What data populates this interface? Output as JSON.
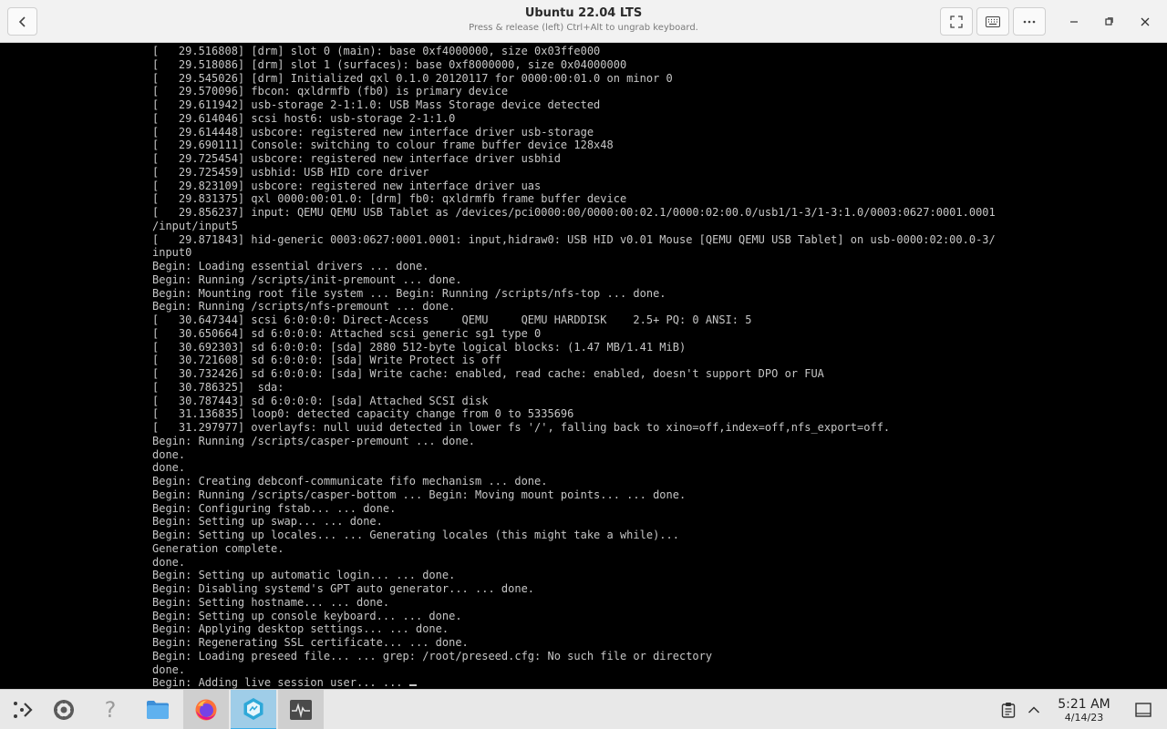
{
  "window": {
    "title": "Ubuntu 22.04 LTS",
    "subtitle": "Press & release (left) Ctrl+Alt to ungrab keyboard."
  },
  "terminal": {
    "lines": [
      "[   29.516808] [drm] slot 0 (main): base 0xf4000000, size 0x03ffe000",
      "[   29.518086] [drm] slot 1 (surfaces): base 0xf8000000, size 0x04000000",
      "[   29.545026] [drm] Initialized qxl 0.1.0 20120117 for 0000:00:01.0 on minor 0",
      "[   29.570096] fbcon: qxldrmfb (fb0) is primary device",
      "[   29.611942] usb-storage 2-1:1.0: USB Mass Storage device detected",
      "[   29.614046] scsi host6: usb-storage 2-1:1.0",
      "[   29.614448] usbcore: registered new interface driver usb-storage",
      "[   29.690111] Console: switching to colour frame buffer device 128x48",
      "[   29.725454] usbcore: registered new interface driver usbhid",
      "[   29.725459] usbhid: USB HID core driver",
      "[   29.823109] usbcore: registered new interface driver uas",
      "[   29.831375] qxl 0000:00:01.0: [drm] fb0: qxldrmfb frame buffer device",
      "[   29.856237] input: QEMU QEMU USB Tablet as /devices/pci0000:00/0000:00:02.1/0000:02:00.0/usb1/1-3/1-3:1.0/0003:0627:0001.0001",
      "/input/input5",
      "[   29.871843] hid-generic 0003:0627:0001.0001: input,hidraw0: USB HID v0.01 Mouse [QEMU QEMU USB Tablet] on usb-0000:02:00.0-3/",
      "input0",
      "Begin: Loading essential drivers ... done.",
      "Begin: Running /scripts/init-premount ... done.",
      "Begin: Mounting root file system ... Begin: Running /scripts/nfs-top ... done.",
      "Begin: Running /scripts/nfs-premount ... done.",
      "[   30.647344] scsi 6:0:0:0: Direct-Access     QEMU     QEMU HARDDISK    2.5+ PQ: 0 ANSI: 5",
      "[   30.650664] sd 6:0:0:0: Attached scsi generic sg1 type 0",
      "[   30.692303] sd 6:0:0:0: [sda] 2880 512-byte logical blocks: (1.47 MB/1.41 MiB)",
      "[   30.721608] sd 6:0:0:0: [sda] Write Protect is off",
      "[   30.732426] sd 6:0:0:0: [sda] Write cache: enabled, read cache: enabled, doesn't support DPO or FUA",
      "[   30.786325]  sda:",
      "[   30.787443] sd 6:0:0:0: [sda] Attached SCSI disk",
      "[   31.136835] loop0: detected capacity change from 0 to 5335696",
      "[   31.297977] overlayfs: null uuid detected in lower fs '/', falling back to xino=off,index=off,nfs_export=off.",
      "Begin: Running /scripts/casper-premount ... done.",
      "done.",
      "done.",
      "Begin: Creating debconf-communicate fifo mechanism ... done.",
      "Begin: Running /scripts/casper-bottom ... Begin: Moving mount points... ... done.",
      "Begin: Configuring fstab... ... done.",
      "Begin: Setting up swap... ... done.",
      "Begin: Setting up locales... ... Generating locales (this might take a while)...",
      "Generation complete.",
      "done.",
      "Begin: Setting up automatic login... ... done.",
      "Begin: Disabling systemd's GPT auto generator... ... done.",
      "Begin: Setting hostname... ... done.",
      "Begin: Setting up console keyboard... ... done.",
      "Begin: Applying desktop settings... ... done.",
      "Begin: Regenerating SSL certificate... ... done.",
      "Begin: Loading preseed file... ... grep: /root/preseed.cfg: No such file or directory",
      "done.",
      "Begin: Adding live session user... ... "
    ]
  },
  "taskbar": {
    "launcher": {
      "icon": "application-launcher-icon"
    },
    "apps": [
      {
        "name": "system-settings",
        "icon": "settings-icon"
      },
      {
        "name": "help",
        "icon": "help-icon"
      },
      {
        "name": "file-manager",
        "icon": "folder-icon"
      },
      {
        "name": "firefox",
        "icon": "firefox-icon"
      },
      {
        "name": "virtual-machine-manager",
        "icon": "vm-manager-icon"
      },
      {
        "name": "system-monitor",
        "icon": "system-monitor-icon"
      }
    ],
    "clock": {
      "time": "5:21 AM",
      "date": "4/14/23"
    }
  },
  "colors": {
    "terminal_bg": "#000000",
    "terminal_fg": "#c6c6c6",
    "accent": "#3daee9"
  }
}
